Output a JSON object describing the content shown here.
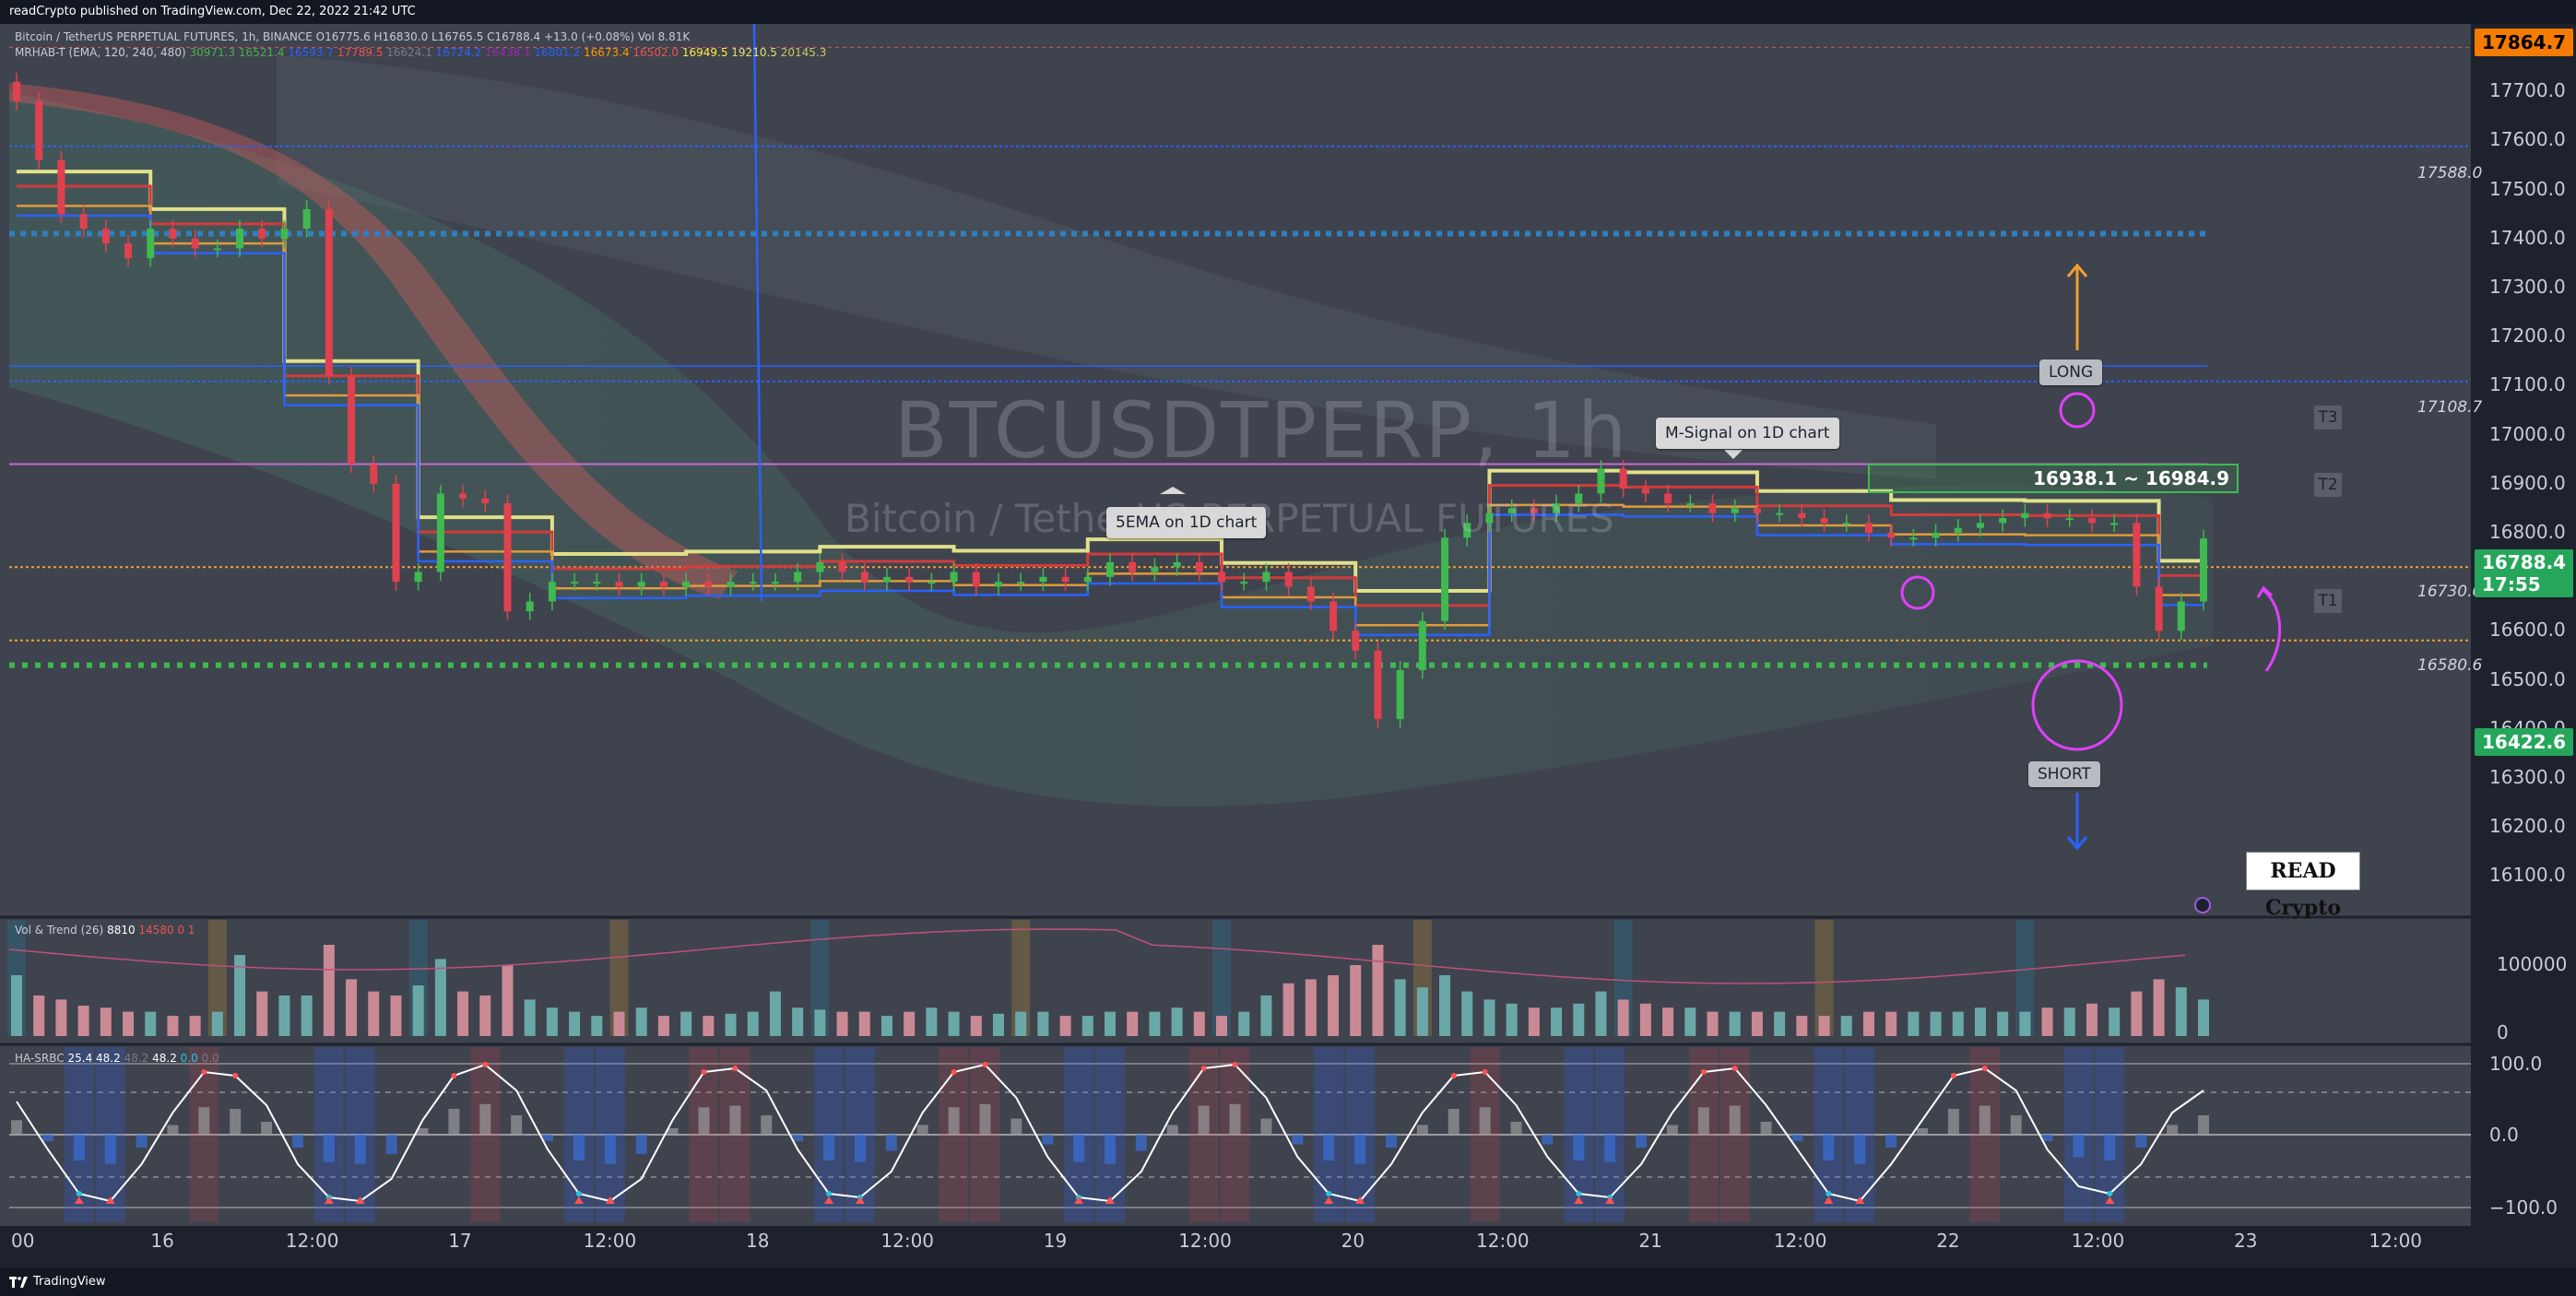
{
  "header": {
    "publisher_text": "readCrypto published on TradingView.com, Dec 22, 2022 21:42 UTC"
  },
  "footer": {
    "brand_text": "TradingView"
  },
  "legend": {
    "main_line": "Bitcoin / TetherUS PERPETUAL FUTURES, 1h, BINANCE  O16775.6  H16830.0  L16765.5  C16788.4 +13.0 (+0.08%)  Vol 8.81K",
    "mrhab_prefix": "MRHAB-T (EMA, 120, 240, 480)",
    "mrhab_values": [
      "30971.3",
      "16521.4",
      "16593.7",
      "17789.5",
      "16624.1",
      "16724.2",
      "16438.1",
      "16801.2",
      "16673.4",
      "16502.0",
      "16949.5",
      "19210.5",
      "20145.3"
    ],
    "vol_prefix": "Vol & Trend (26)",
    "vol_values": [
      "8810",
      "14580",
      "0",
      "1"
    ],
    "ha_prefix": "HA-SRBC",
    "ha_values": [
      "25.4",
      "48.2",
      "48.2",
      "48.2",
      "0.0",
      "0.0"
    ]
  },
  "watermark": {
    "symbol": "BTCUSDTPERP, 1h",
    "description": "Bitcoin / TetherUS PERPETUAL FUTURES"
  },
  "annotations": {
    "ema_callout": "5EMA on 1D chart",
    "msignal_callout": "M-Signal on 1D chart",
    "range_box": "16938.1 ~ 16984.9",
    "long_label": "LONG",
    "short_label": "SHORT",
    "t1": "T1",
    "t2": "T2",
    "t3": "T3",
    "level_17588": "17588.0",
    "level_17108": "17108.7",
    "level_16730": "16730.0",
    "level_16580": "16580.6",
    "logo_text": "READ Crypto"
  },
  "price_axis": {
    "ticks": [
      "17800.0",
      "17700.0",
      "17600.0",
      "17500.0",
      "17400.0",
      "17300.0",
      "17200.0",
      "17100.0",
      "17000.0",
      "16900.0",
      "16800.0",
      "16700.0",
      "16600.0",
      "16500.0",
      "16400.0",
      "16300.0",
      "16200.0",
      "16100.0"
    ],
    "top_tag": "17864.7",
    "current_price": "16788.4",
    "countdown": "17:55",
    "low_tag": "16422.6",
    "top_tag_color": "#f57c00",
    "current_tag_color": "#26a65b",
    "low_tag_color": "#26a65b"
  },
  "volume_axis": {
    "ticks": [
      "100000",
      "0"
    ]
  },
  "osc_axis": {
    "ticks": [
      "100.0",
      "0.0",
      "−100.0"
    ]
  },
  "time_axis": {
    "ticks": [
      "00",
      "16",
      "12:00",
      "17",
      "12:00",
      "18",
      "12:00",
      "19",
      "12:00",
      "20",
      "12:00",
      "21",
      "12:00",
      "22",
      "12:00",
      "23",
      "12:00"
    ]
  },
  "chart_data": {
    "type": "candlestick",
    "symbol": "BTCUSDTPERP",
    "timeframe": "1h",
    "ylim": [
      16050,
      17870
    ],
    "close_series": [
      17680,
      17560,
      17450,
      17420,
      17390,
      17360,
      17420,
      17400,
      17380,
      17380,
      17420,
      17400,
      17420,
      17460,
      17120,
      16940,
      16900,
      16700,
      16720,
      16880,
      16870,
      16860,
      16640,
      16660,
      16700,
      16700,
      16700,
      16690,
      16700,
      16690,
      16700,
      16690,
      16700,
      16700,
      16700,
      16720,
      16740,
      16720,
      16700,
      16710,
      16700,
      16700,
      16720,
      16690,
      16700,
      16700,
      16710,
      16700,
      16710,
      16740,
      16720,
      16730,
      16740,
      16720,
      16700,
      16700,
      16720,
      16690,
      16660,
      16600,
      16560,
      16420,
      16520,
      16620,
      16790,
      16820,
      16840,
      16850,
      16840,
      16860,
      16880,
      16930,
      16890,
      16880,
      16860,
      16860,
      16840,
      16850,
      16840,
      16840,
      16830,
      16820,
      16820,
      16800,
      16790,
      16790,
      16800,
      16810,
      16820,
      16830,
      16840,
      16830,
      16830,
      16820,
      16820,
      16690,
      16600,
      16660,
      16788.4
    ],
    "horizontal_levels": [
      17588.0,
      17108.7,
      16730.0,
      16580.6,
      16938.1,
      16984.9
    ],
    "volume": [
      30,
      20,
      18,
      15,
      14,
      12,
      12,
      10,
      10,
      12,
      40,
      22,
      20,
      20,
      45,
      28,
      22,
      20,
      25,
      38,
      22,
      20,
      35,
      18,
      14,
      12,
      10,
      12,
      14,
      10,
      12,
      10,
      11,
      12,
      22,
      14,
      13,
      12,
      12,
      10,
      12,
      14,
      12,
      10,
      11,
      12,
      12,
      10,
      10,
      12,
      12,
      12,
      14,
      12,
      10,
      12,
      20,
      26,
      28,
      30,
      35,
      45,
      28,
      24,
      30,
      22,
      18,
      16,
      14,
      14,
      16,
      22,
      18,
      16,
      14,
      14,
      12,
      12,
      12,
      12,
      10,
      10,
      10,
      12,
      12,
      12,
      12,
      12,
      14,
      12,
      12,
      14,
      14,
      16,
      14,
      22,
      28,
      24,
      18
    ],
    "oscillator": [
      45,
      -20,
      -80,
      -90,
      -40,
      30,
      85,
      80,
      40,
      -40,
      -85,
      -90,
      -60,
      20,
      80,
      95,
      60,
      -20,
      -80,
      -90,
      -60,
      20,
      85,
      90,
      60,
      -20,
      -80,
      -85,
      -50,
      30,
      85,
      95,
      50,
      -30,
      -85,
      -90,
      -50,
      30,
      90,
      95,
      50,
      -30,
      -80,
      -90,
      -40,
      30,
      80,
      85,
      40,
      -30,
      -80,
      -85,
      -40,
      30,
      85,
      90,
      40,
      -20,
      -80,
      -90,
      -40,
      20,
      80,
      90,
      60,
      -20,
      -70,
      -80,
      -40,
      30,
      60
    ]
  }
}
